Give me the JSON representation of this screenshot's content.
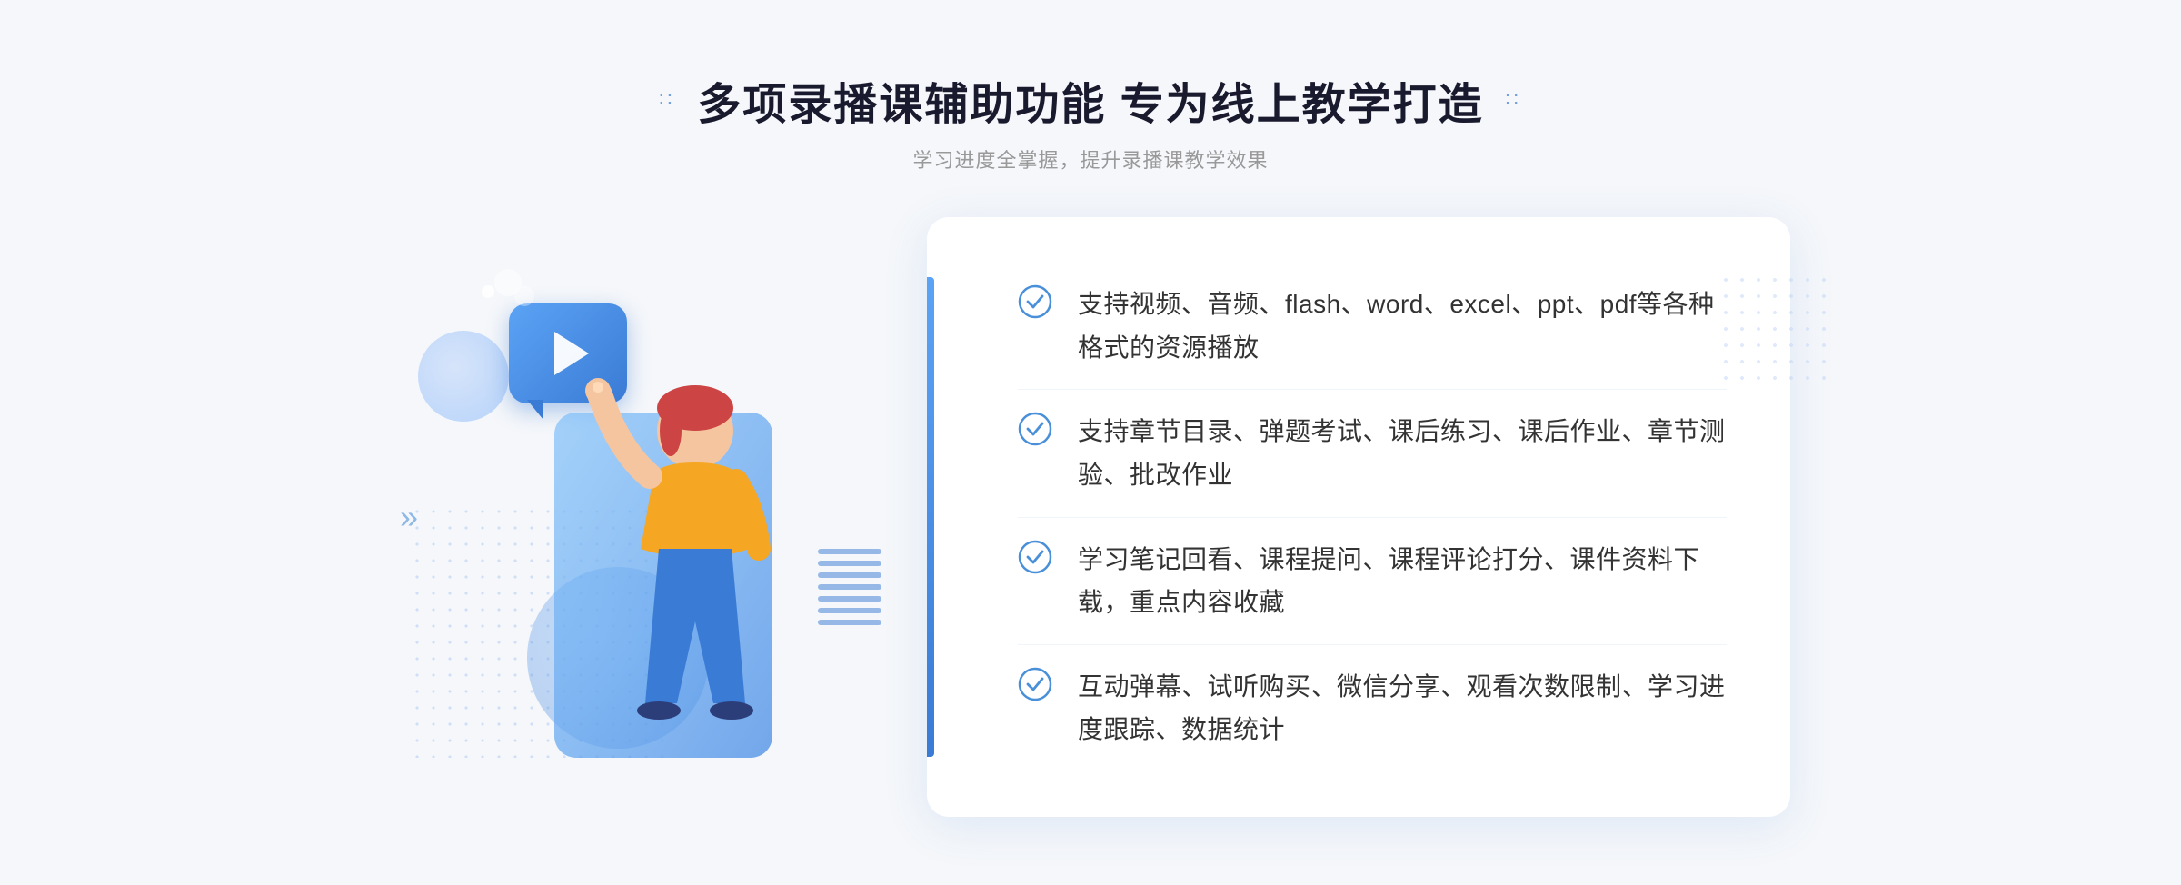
{
  "page": {
    "title": "多项录播课辅助功能 专为线上教学打造",
    "subtitle": "学习进度全掌握，提升录播课教学效果",
    "decorative_dots_left": "∷",
    "decorative_dots_right": "∷",
    "chevron_left": "»"
  },
  "features": [
    {
      "id": "feature-1",
      "text": "支持视频、音频、flash、word、excel、ppt、pdf等各种格式的资源播放"
    },
    {
      "id": "feature-2",
      "text": "支持章节目录、弹题考试、课后练习、课后作业、章节测验、批改作业"
    },
    {
      "id": "feature-3",
      "text": "学习笔记回看、课程提问、课程评论打分、课件资料下载，重点内容收藏"
    },
    {
      "id": "feature-4",
      "text": "互动弹幕、试听购买、微信分享、观看次数限制、学习进度跟踪、数据统计"
    }
  ],
  "colors": {
    "primary_blue": "#3a7bd5",
    "light_blue": "#5ba3f5",
    "text_dark": "#1a1a2e",
    "text_gray": "#999999",
    "text_body": "#333333",
    "card_bg": "#ffffff",
    "page_bg": "#f5f7fa"
  }
}
